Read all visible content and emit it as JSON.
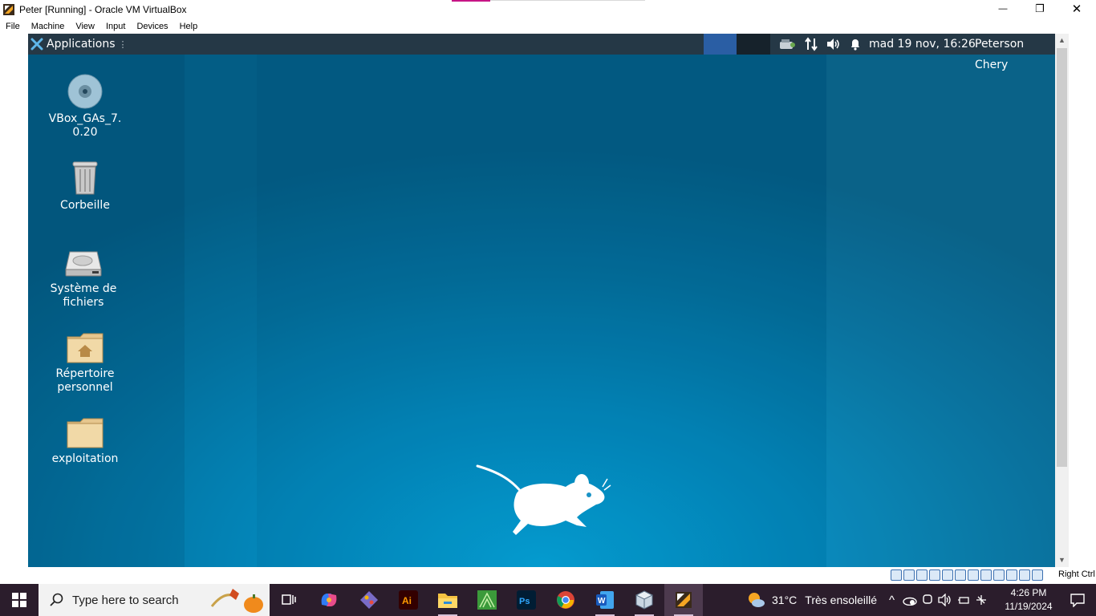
{
  "window": {
    "title": "Peter [Running] - Oracle VM VirtualBox",
    "controls": {
      "minimize": "—",
      "maximize": "❐",
      "close": "✕"
    }
  },
  "menubar": {
    "items": [
      "File",
      "Machine",
      "View",
      "Input",
      "Devices",
      "Help"
    ]
  },
  "xfce_panel": {
    "applications_label": "Applications",
    "separator": "⋮",
    "datetime": "mad 19 nov, 16:26",
    "username": "Peterson Chery"
  },
  "desktop": {
    "icons": [
      {
        "label": "VBox_GAs_7.\n0.20",
        "line1": "VBox_GAs_7.",
        "line2": "0.20",
        "icon": "disc-icon"
      },
      {
        "label": "Corbeille",
        "line1": "Corbeille",
        "line2": "",
        "icon": "trash-icon"
      },
      {
        "label": "Système de fichiers",
        "line1": "Système de",
        "line2": "fichiers",
        "icon": "drive-icon"
      },
      {
        "label": "Répertoire personnel",
        "line1": "Répertoire",
        "line2": "personnel",
        "icon": "home-folder-icon"
      },
      {
        "label": "exploitation",
        "line1": "exploitation",
        "line2": "",
        "icon": "folder-icon"
      }
    ]
  },
  "vbox_status": {
    "host_key": "Right Ctrl"
  },
  "taskbar": {
    "search_placeholder": "Type here to search",
    "weather_temp": "31°C",
    "weather_text": "Très ensoleillé",
    "time": "4:26 PM",
    "date": "11/19/2024",
    "tray_chevron": "^"
  },
  "colors": {
    "xfce_panel": "#253846",
    "workspace_active": "#2a5ea4",
    "desktop_top": "#035d85",
    "desktop_bottom": "#05a3d8",
    "taskbar": "#2b1d2c"
  }
}
